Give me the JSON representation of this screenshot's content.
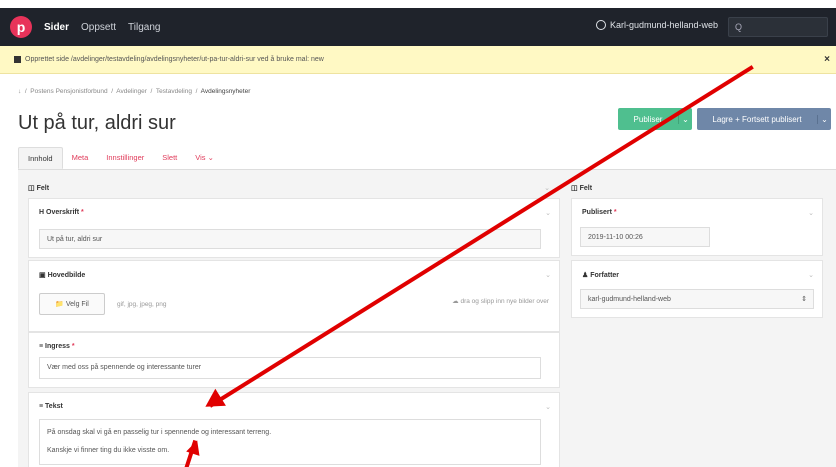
{
  "topbar": {
    "logo": "p",
    "nav": [
      "Sider",
      "Oppsett",
      "Tilgang"
    ],
    "user": "Karl-gudmund-helland-web",
    "search_placeholder": "Q"
  },
  "notice": {
    "text": "Opprettet side /avdelinger/testavdeling/avdelingsnyheter/ut-pa-tur-aldri-sur ved å bruke mal: new",
    "close": "×"
  },
  "breadcrumb": [
    "Postens Pensjonistforbund",
    "Avdelinger",
    "Testavdeling",
    "Avdelingsnyheter"
  ],
  "page": {
    "title": "Ut på tur, aldri sur",
    "publish_label": "Publiser",
    "save_label": "Lagre + Fortsett publisert",
    "caret": "⌄"
  },
  "tabs": [
    "Innhold",
    "Meta",
    "Innstillinger",
    "Slett",
    "Vis ⌄"
  ],
  "left": {
    "panel_title": "Felt",
    "overskrift_label": "Overskrift",
    "overskrift_value": "Ut på tur, aldri sur",
    "hovedbilde_label": "Hovedbilde",
    "file_button": "Velg Fil",
    "file_types": "gif, jpg, jpeg, png",
    "drop_hint": "dra og slipp inn nye bilder over",
    "ingress_label": "Ingress",
    "ingress_value": "Vær med oss på spennende og interessante turer",
    "tekst_label": "Tekst",
    "tekst_line1": "På onsdag skal vi gå en passelig tur i spennende og interessant terreng.",
    "tekst_line2": "Kanskje vi finner ting du ikke visste om."
  },
  "right": {
    "panel_title": "Felt",
    "publisert_label": "Publisert",
    "publisert_value": "2019-11-10 00:26",
    "forfatter_label": "Forfatter",
    "forfatter_value": "karl-gudmund-helland-web"
  },
  "colors": {
    "accent": "#e8335a",
    "publish": "#4fbf8f",
    "save": "#6f87a8",
    "annotation_arrow": "#e00000"
  }
}
